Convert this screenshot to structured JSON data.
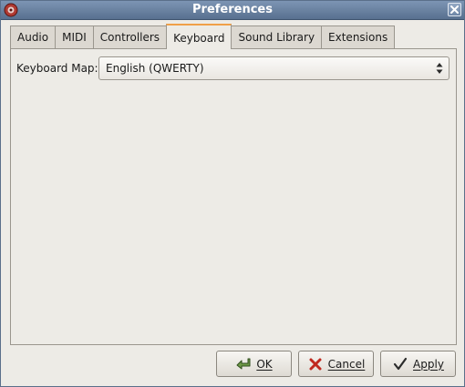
{
  "window": {
    "title": "Preferences",
    "icons": {
      "app": "app-icon",
      "close": "close-icon"
    }
  },
  "tabs": [
    {
      "label": "Audio",
      "active": false
    },
    {
      "label": "MIDI",
      "active": false
    },
    {
      "label": "Controllers",
      "active": false
    },
    {
      "label": "Keyboard",
      "active": true
    },
    {
      "label": "Sound Library",
      "active": false
    },
    {
      "label": "Extensions",
      "active": false
    }
  ],
  "keyboard": {
    "keymap_label": "Keyboard Map:",
    "keymap_value": "English (QWERTY)"
  },
  "buttons": {
    "ok": {
      "label": "OK",
      "icon": "ok-icon"
    },
    "cancel": {
      "label": "Cancel",
      "icon": "cancel-icon"
    },
    "apply": {
      "label": "Apply",
      "icon": "checkmark-icon"
    }
  },
  "colors": {
    "titlebar": "#6b84a3",
    "active_tab_accent": "#f0a048",
    "window_bg": "#edebe6"
  }
}
